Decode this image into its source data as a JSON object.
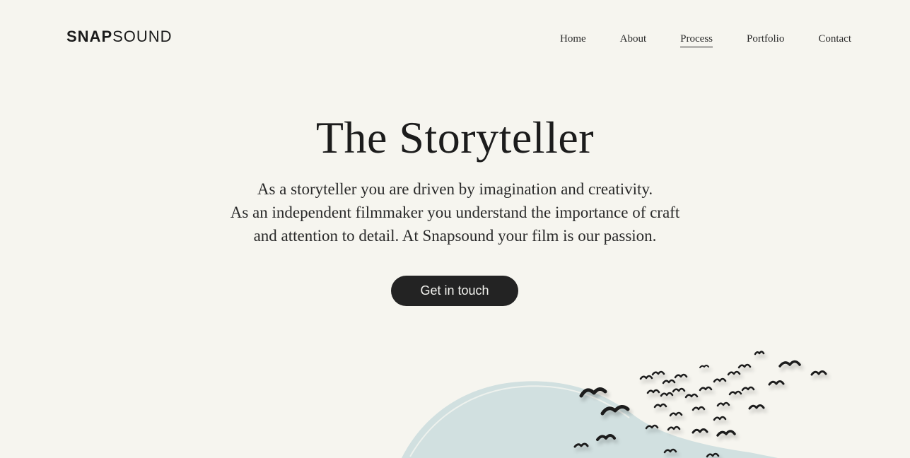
{
  "brand": {
    "part1": "SNAP",
    "part2": "SOUND"
  },
  "nav": {
    "items": [
      {
        "label": "Home"
      },
      {
        "label": "About"
      },
      {
        "label": "Process",
        "active": true
      },
      {
        "label": "Portfolio"
      },
      {
        "label": "Contact"
      }
    ]
  },
  "hero": {
    "title": "The Storyteller",
    "lines": [
      "As a storyteller you are driven by imagination and creativity.",
      "As an independent filmmaker you understand the importance of craft",
      "and attention to detail. At Snapsound your film is our passion."
    ],
    "cta_label": "Get in touch"
  },
  "illustration": {
    "icon": "birds-over-hill-illustration",
    "colors": {
      "hill": "#d1e0e0",
      "birds": "#1f1f1f",
      "background": "#f6f5ef"
    }
  }
}
